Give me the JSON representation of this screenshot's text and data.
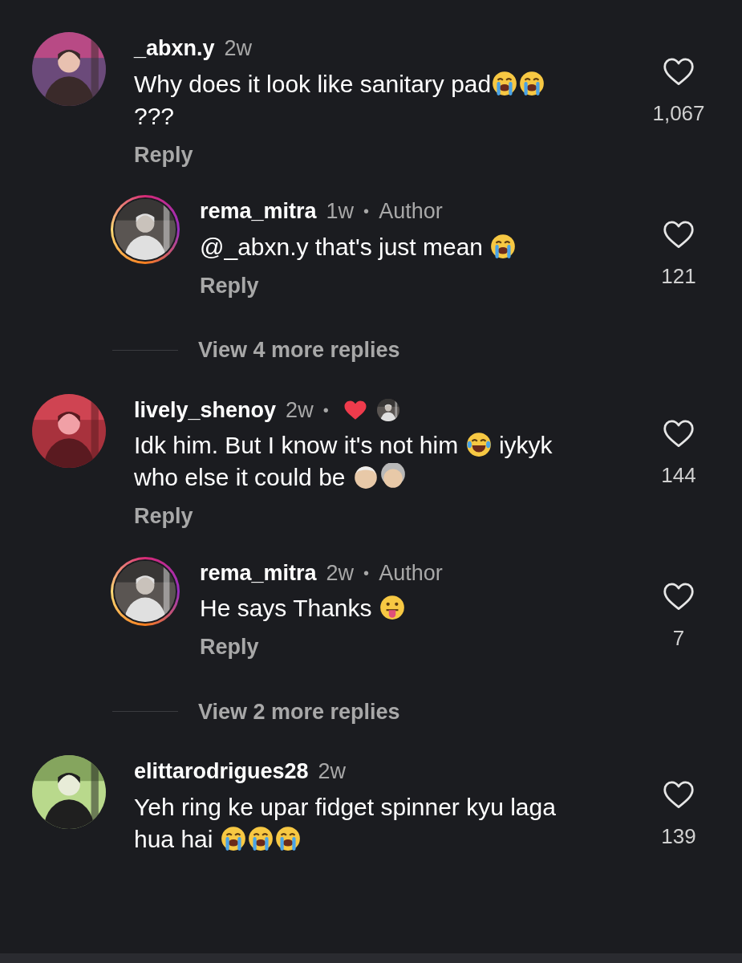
{
  "items": [
    {
      "kind": "comment",
      "reply": false,
      "story_ring": false,
      "username": "_abxn.y",
      "time": "2w",
      "liked_by_author": false,
      "parts": [
        {
          "kind": "text",
          "text": "Why does it look like sanitary pad"
        },
        {
          "kind": "crying_emoji"
        },
        {
          "kind": "text",
          "text": "???"
        },
        {
          "kind": "crying_emoji_before"
        }
      ],
      "action": "Reply",
      "likes": "1,067"
    },
    {
      "kind": "comment",
      "reply": true,
      "story_ring": true,
      "username": "rema_mitra",
      "time": "1w",
      "separator": "•",
      "badge": "Author",
      "liked_by_author": false,
      "parts": [
        {
          "kind": "text",
          "text": "@_abxn.y that's just mean "
        },
        {
          "kind": "crying_emoji"
        }
      ],
      "action": "Reply",
      "likes": "121"
    },
    {
      "kind": "more",
      "label": "View 4 more replies"
    },
    {
      "kind": "comment",
      "reply": false,
      "story_ring": false,
      "username": "lively_shenoy",
      "time": "2w",
      "separator": "•",
      "liked_by_author": true,
      "parts": [
        {
          "kind": "text",
          "text": "Idk him. But I know it's not him "
        },
        {
          "kind": "laughing_emoji"
        },
        {
          "kind": "text",
          "text": " iykyk who else it could be "
        },
        {
          "kind": "old_man_emoji"
        },
        {
          "kind": "old_woman_emoji"
        }
      ],
      "action": "Reply",
      "likes": "144"
    },
    {
      "kind": "comment",
      "reply": true,
      "story_ring": true,
      "username": "rema_mitra",
      "time": "2w",
      "separator": "•",
      "badge": "Author",
      "liked_by_author": false,
      "parts": [
        {
          "kind": "text",
          "text": "He says Thanks "
        },
        {
          "kind": "tongue_emoji"
        }
      ],
      "action": "Reply",
      "likes": "7"
    },
    {
      "kind": "more",
      "label": "View 2 more replies"
    },
    {
      "kind": "comment",
      "reply": false,
      "story_ring": false,
      "username": "elittarodrigues28",
      "time": "2w",
      "liked_by_author": false,
      "parts": [
        {
          "kind": "text",
          "text": "Yeh ring ke upar fidget spinner kyu laga hua hai "
        },
        {
          "kind": "crying_emoji"
        },
        {
          "kind": "crying_emoji"
        },
        {
          "kind": "crying_emoji"
        }
      ],
      "likes": "139"
    }
  ]
}
